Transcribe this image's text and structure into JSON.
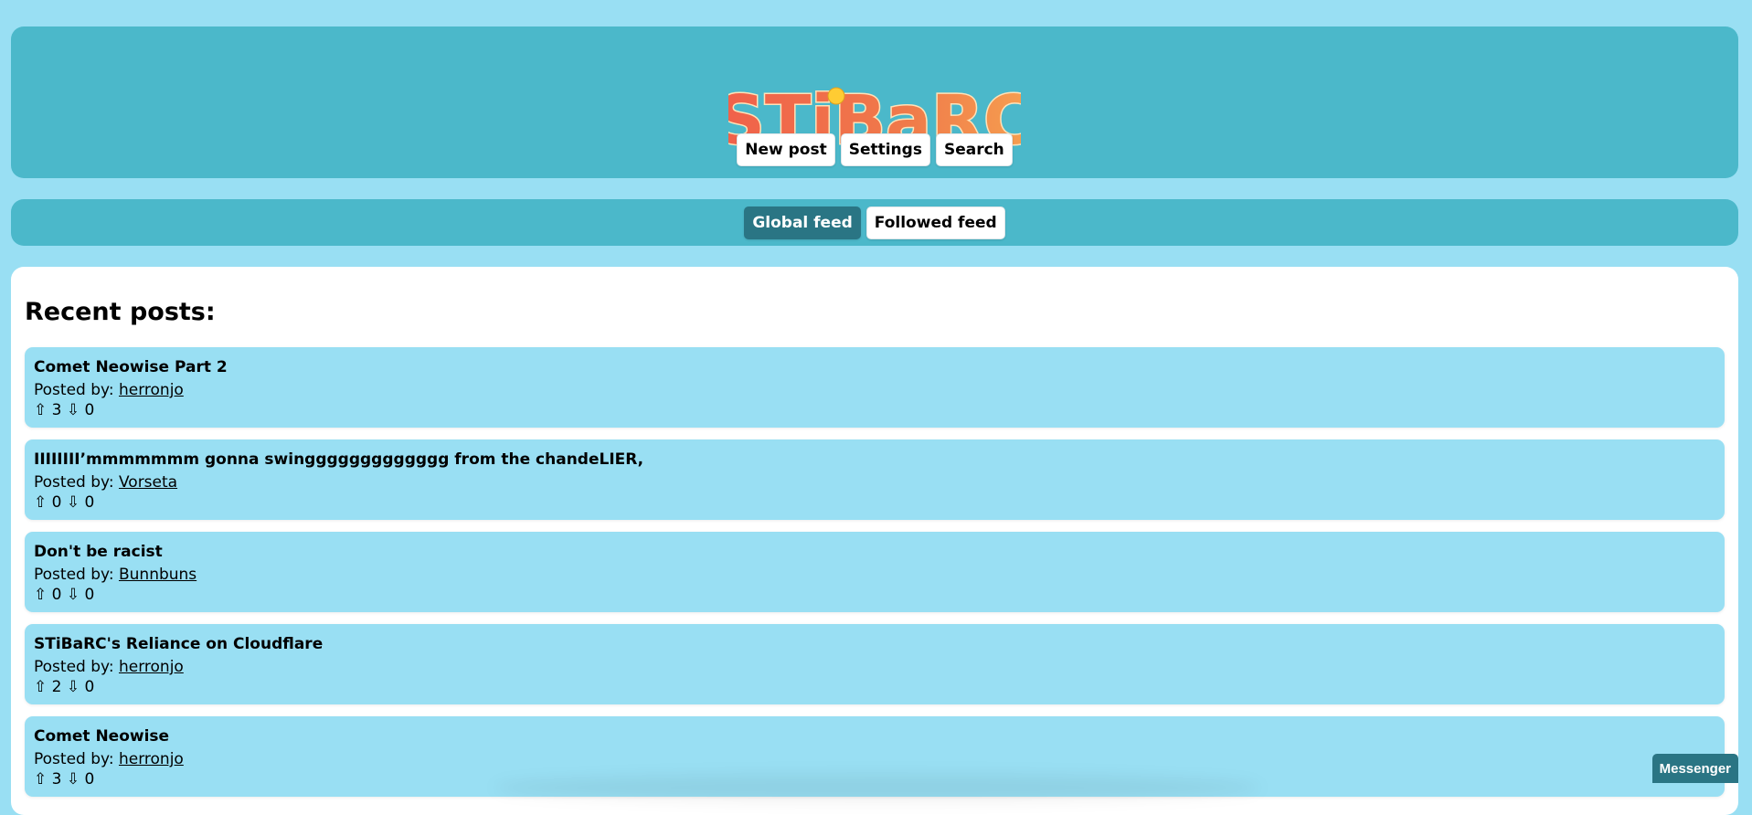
{
  "header": {
    "logo_text": "STiBaRC",
    "nav": [
      {
        "label": "New post"
      },
      {
        "label": "Settings"
      },
      {
        "label": "Search"
      }
    ]
  },
  "feed_tabs": [
    {
      "label": "Global feed",
      "active": true
    },
    {
      "label": "Followed feed",
      "active": false
    }
  ],
  "main": {
    "heading": "Recent posts:",
    "posted_by_label": "Posted by:",
    "upvote_glyph": "⇧",
    "downvote_glyph": "⇩",
    "posts": [
      {
        "title": "Comet Neowise Part 2",
        "author": "herronjo",
        "up": "3",
        "down": "0"
      },
      {
        "title": "IIIIIIII’mmmmmmm gonna swinggggggggggggg from the chandeLIER,",
        "author": "Vorseta",
        "up": "0",
        "down": "0"
      },
      {
        "title": "Don't be racist",
        "author": "Bunnbuns",
        "up": "0",
        "down": "0"
      },
      {
        "title": "STiBaRC's Reliance on Cloudflare",
        "author": "herronjo",
        "up": "2",
        "down": "0"
      },
      {
        "title": "Comet Neowise",
        "author": "herronjo",
        "up": "3",
        "down": "0"
      }
    ]
  },
  "messenger": {
    "label": "Messenger"
  },
  "colors": {
    "page_bg": "#99dff3",
    "panel_bg": "#4bb8ca",
    "active_tab": "#2a7584",
    "logo_fill": "#f07050",
    "logo_outline": "#ffd6a0"
  }
}
